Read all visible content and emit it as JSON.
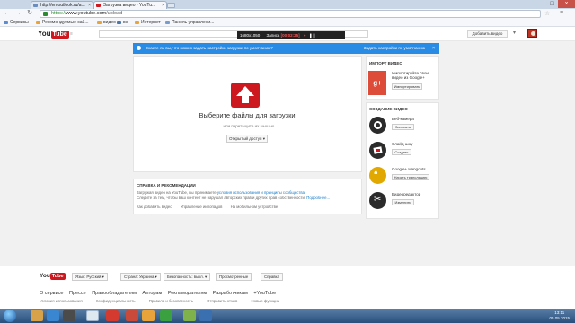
{
  "browser": {
    "tabs": [
      {
        "label": "http://emoutlook.ru/a..."
      },
      {
        "label": "Загрузка видео - YouTu..."
      }
    ],
    "url_scheme": "https://",
    "url_host": "www.youtube.com",
    "url_path": "/upload",
    "bookmarks": [
      {
        "label": "Сервисы"
      },
      {
        "label": "Рекомендуемые сай..."
      },
      {
        "label": "видео"
      },
      {
        "label": "вк"
      },
      {
        "label": "Интернет"
      },
      {
        "label": "Панель управлени..."
      }
    ]
  },
  "header": {
    "logo_you": "You",
    "logo_tube": "Tube",
    "locale": "RU",
    "upload_button": "Добавить видео"
  },
  "recorder": {
    "resolution": "1680x1050",
    "label": "Запись",
    "time": "[00:02:25]"
  },
  "banner": {
    "text": "Знаете ли вы, что можно задать настройки загрузки по умолчанию?",
    "link": "Задать настройки по умолчанию",
    "close": "×"
  },
  "upload": {
    "title": "Выберите файлы для загрузки",
    "subtitle": "...или перетащите их мышью",
    "privacy": "Открытый доступ ▾"
  },
  "help": {
    "title": "СПРАВКА И РЕКОМЕНДАЦИИ",
    "line1_text": "Загружая видео на YouTube, вы принимаете ",
    "line1_link": "условия использования и принципы сообщества.",
    "line2_text": "Следите за тем, чтобы ваш контент не нарушал авторских прав и других прав собственности. ",
    "line2_link": "Подробнее...",
    "links": [
      "Как добавить видео",
      "Управление иипопадов",
      "На мобильном устройстве"
    ]
  },
  "import": {
    "title": "ИМПОРТ ВИДЕО",
    "gplus_label": "g+",
    "text_line1": "Импортируйте свои",
    "text_line2": "видео из Google+",
    "button": "Импортировать"
  },
  "create": {
    "title": "СОЗДАНИЕ ВИДЕО",
    "items": [
      {
        "label": "Веб-камера",
        "button": "Записать"
      },
      {
        "label": "Слайд-шоу",
        "button": "Создать"
      },
      {
        "label": "Google+ Hangouts",
        "button": "Начать трансляцию"
      },
      {
        "label": "Видеоредактор",
        "button": "Изменить"
      }
    ]
  },
  "footer": {
    "logo_you": "You",
    "logo_tube": "Tube",
    "buttons": [
      "Язык: Русский ▾",
      "Страна: Украина ▾",
      "Безопасность: выкл. ▾",
      "Просмотренные",
      "Справка"
    ],
    "nav": [
      "О сервисе",
      "Прессе",
      "Правообладателям",
      "Авторам",
      "Рекламодателям",
      "Разработчикам",
      "+YouTube"
    ],
    "sub": [
      "Условия использования",
      "Конфиденциальность",
      "Правила и безопасность",
      "Отправить отзыв",
      "Новые функции"
    ]
  },
  "taskbar": {
    "time": "13:11",
    "date": "05.05.2015"
  },
  "colors": {
    "youtube_red": "#cc181e",
    "banner_blue": "#2a8be4",
    "gplus_red": "#dd4b39",
    "link_blue": "#167ac6"
  }
}
